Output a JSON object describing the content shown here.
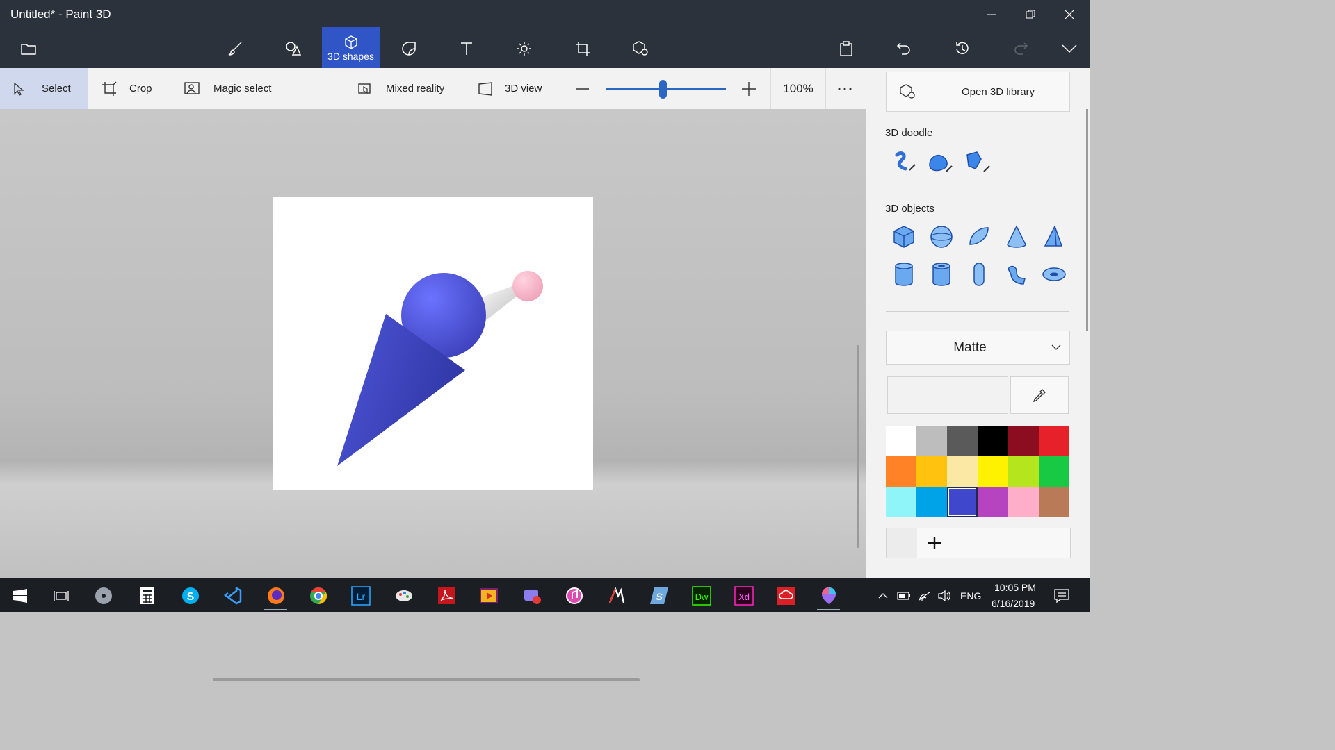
{
  "window": {
    "title": "Untitled* - Paint 3D"
  },
  "ribbon": {
    "active_tab_label": "3D shapes"
  },
  "toolbar": {
    "select": "Select",
    "crop": "Crop",
    "magic_select": "Magic select",
    "mixed_reality": "Mixed reality",
    "view_3d": "3D view",
    "zoom": "100%",
    "zoom_level": 0.47
  },
  "panel": {
    "open_library": "Open 3D library",
    "doodle_title": "3D doodle",
    "objects_title": "3D objects",
    "material": "Matte",
    "palette": [
      "#ffffff",
      "#bdbdbd",
      "#5a5a5a",
      "#000000",
      "#8b0d1f",
      "#e6212a",
      "#ff8326",
      "#ffc20e",
      "#fbe8a4",
      "#fff200",
      "#b5e61d",
      "#18c943",
      "#8ff5f8",
      "#00a2e8",
      "#3f48cc",
      "#b643c0",
      "#ffaec9",
      "#b97a57"
    ],
    "selected_color": "#3f48cc"
  },
  "taskbar": {
    "language": "ENG",
    "time": "10:05 PM",
    "date": "6/16/2019",
    "apps": [
      "Lr",
      "Dw",
      "Xd"
    ]
  },
  "colors": {
    "accent": "#2f55c7",
    "shape_blue": "#4b52e0",
    "ball_pink": "#f7b3c7"
  }
}
